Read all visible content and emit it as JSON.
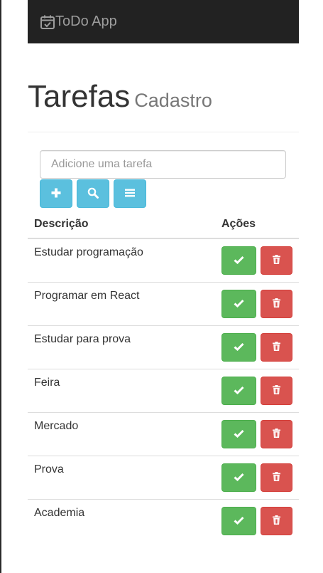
{
  "navbar": {
    "brand": "ToDo App",
    "brand_icon": "calendar-check-icon"
  },
  "header": {
    "title": "Tarefas",
    "subtitle": "Cadastro"
  },
  "form": {
    "placeholder": "Adicione uma tarefa",
    "value": "",
    "buttons": [
      {
        "icon": "plus-icon",
        "action": "add"
      },
      {
        "icon": "search-icon",
        "action": "search"
      },
      {
        "icon": "menu-icon",
        "action": "clear"
      }
    ]
  },
  "table": {
    "headers": [
      "Descrição",
      "Ações"
    ],
    "rows": [
      {
        "description": "Estudar programação"
      },
      {
        "description": "Programar em React"
      },
      {
        "description": "Estudar para prova"
      },
      {
        "description": "Feira"
      },
      {
        "description": "Mercado"
      },
      {
        "description": "Prova"
      },
      {
        "description": "Academia"
      }
    ]
  },
  "colors": {
    "navbar_bg": "#222222",
    "info": "#5bc0de",
    "success": "#5cb85c",
    "danger": "#d9534f"
  }
}
